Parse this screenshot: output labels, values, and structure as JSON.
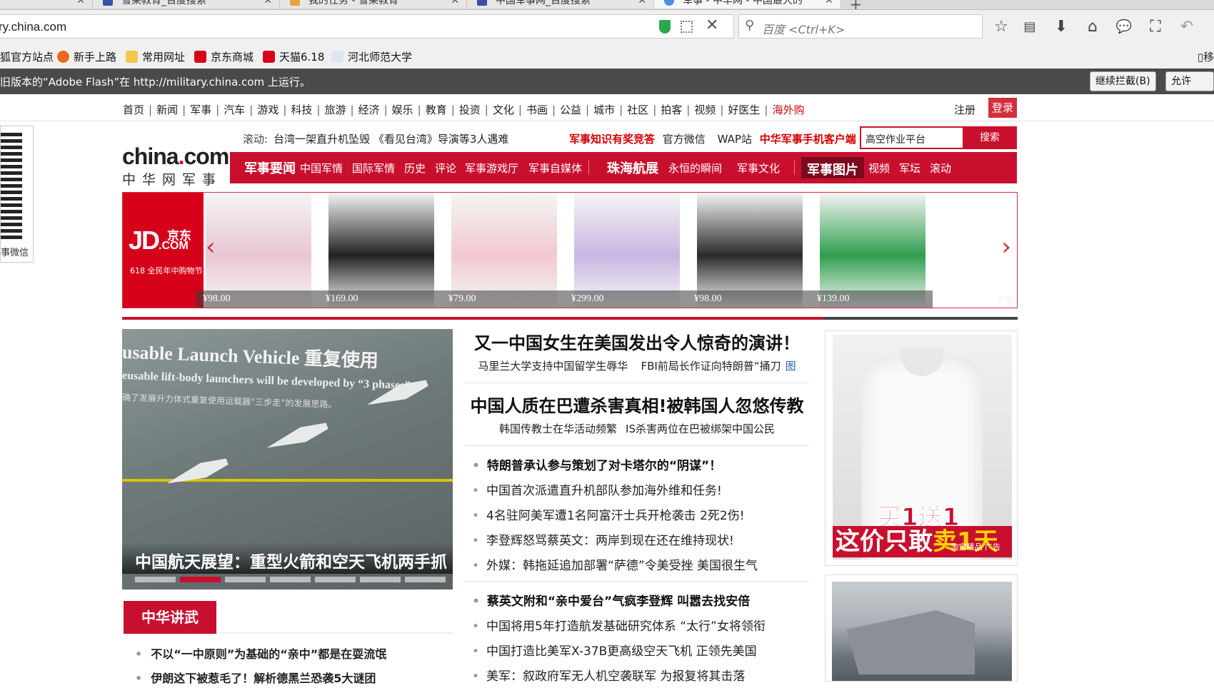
{
  "browser": {
    "tabs": [
      {
        "label": "雪莱教育_百度搜索"
      },
      {
        "label": "我的任务 - 雪莱教育"
      },
      {
        "label": "中国军事网_百度搜索"
      },
      {
        "label": "军事 - 中华网 - 中国最大的"
      }
    ],
    "url": "ry.china.com",
    "search_placeholder": "百度 <Ctrl+K>",
    "bookmarks": [
      "狐官方站点",
      "新手上路",
      "常用网址",
      "京东商城",
      "天猫6.18",
      "河北师范大学"
    ],
    "bookmark_right": "移",
    "flash_notice": "旧版本的“Adobe Flash”在 http://military.china.com 上运行。",
    "flash_block_label": "继续拦截(B)",
    "flash_allow_label": "允许(A)..."
  },
  "topnav": {
    "links": [
      "首页",
      "新闻",
      "军事",
      "汽车",
      "游戏",
      "科技",
      "旅游",
      "经济",
      "娱乐",
      "教育",
      "投资",
      "文化",
      "书画",
      "公益",
      "城市",
      "社区",
      "拍客",
      "视频",
      "好医生",
      "海外购"
    ],
    "register": "注册",
    "login": "登录"
  },
  "qr": {
    "label": "事微信"
  },
  "logo": {
    "main_a": "china",
    "main_dot": ".",
    "main_b": "com",
    "sub": "中华网军事"
  },
  "ticker": {
    "label": "滚动:",
    "text": "台湾一架直升机坠毁 《看见台湾》导演等3人遇难"
  },
  "promo": {
    "quiz": "军事知识有奖竞答",
    "weixin": "官方微信",
    "wap": "WAP站",
    "client": "中华军事手机客户端"
  },
  "site_search": {
    "value": "高空作业平台",
    "button": "搜索"
  },
  "rednav": {
    "a_big": "军事要闻",
    "a_items": [
      "中国军情",
      "国际军情",
      "历史",
      "评论",
      "军事游戏厅",
      "军事自媒体"
    ],
    "b_big": "珠海航展",
    "b_items": [
      "永恒的瞬间",
      "军事文化"
    ],
    "c_big": "军事图片",
    "c_items": [
      "视频",
      "军坛",
      "滚动"
    ]
  },
  "jd_ad": {
    "logo": "JD",
    "logo_small": ".COM",
    "logo_cn": "京东",
    "tagline": "618 全民年中购物节",
    "products": [
      {
        "price": "¥98.00",
        "color": "#e9c6d4"
      },
      {
        "price": "¥169.00",
        "color": "#222222"
      },
      {
        "price": "¥79.00",
        "color": "#f2c9cf"
      },
      {
        "price": "¥299.00",
        "color": "#c9b6e2"
      },
      {
        "price": "¥98.00",
        "color": "#2a2a2a"
      },
      {
        "price": "¥139.00",
        "color": "#2f9e4f"
      }
    ],
    "ad_tag": "广告",
    "prev_icon": "chevron-left-icon",
    "next_icon": "chevron-right-icon"
  },
  "slider": {
    "title_en": "usable Launch Vehicle 重复使用",
    "line2": "eusable lift-body launchers will be developed by “3 phases”.",
    "line3": "确了发展升力体式重复使用运载器“三步走”的发展思路。",
    "caption": "中国航天展望：重型火箭和空天飞机两手抓",
    "active_dot": 1
  },
  "section": {
    "label": "中华讲武",
    "items": [
      "不以“一中原则”为基础的“亲中”都是在耍流氓",
      "伊朗这下被惹毛了！解析德黑兰恐袭5大谜团"
    ]
  },
  "headlines": [
    {
      "title": "又一中国女生在美国发出令人惊奇的演讲！",
      "subs": [
        "马里兰大学支持中国留学生辱华",
        "FBI前局长作证向特朗普“捅刀"
      ]
    },
    {
      "title": "中国人质在巴遭杀害真相!被韩国人忽悠传教",
      "subs": [
        "韩国传教士在华活动频繁",
        "IS杀害两位在巴被绑架中国公民"
      ]
    }
  ],
  "news_group1": [
    {
      "text": "特朗普承认参与策划了对卡塔尔的“阴谋”！",
      "bold": true
    },
    {
      "text": "中国首次派遣直升机部队参加海外维和任务!",
      "bold": false
    },
    {
      "text": "4名驻阿美军遭1名阿富汗士兵开枪袭击 2死2伤!",
      "bold": false
    },
    {
      "text": "李登辉怒骂蔡英文：两岸到现在还在维持现状!",
      "bold": false
    },
    {
      "text": "外媒：韩拖延追加部署“萨德”令美受挫 美国很生气",
      "bold": false
    }
  ],
  "news_group2": [
    {
      "text": "蔡英文附和“亲中爱台”气疯李登辉 叫嚣去找安倍",
      "bold": true
    },
    {
      "text": "中国将用5年打造航发基础研究体系 “太行”女将领衔",
      "bold": false
    },
    {
      "text": "中国打造比美军X-37B更高级空天飞机 正领先美国",
      "bold": false
    },
    {
      "text": "美军：叙政府军无人机空袭联军 为报复将其击落",
      "bold": false
    }
  ],
  "side_ad": {
    "line1": "买1送1",
    "line2a": "这价只敢",
    "line2b": "卖1天",
    "source": "淘宝精品 广告"
  }
}
